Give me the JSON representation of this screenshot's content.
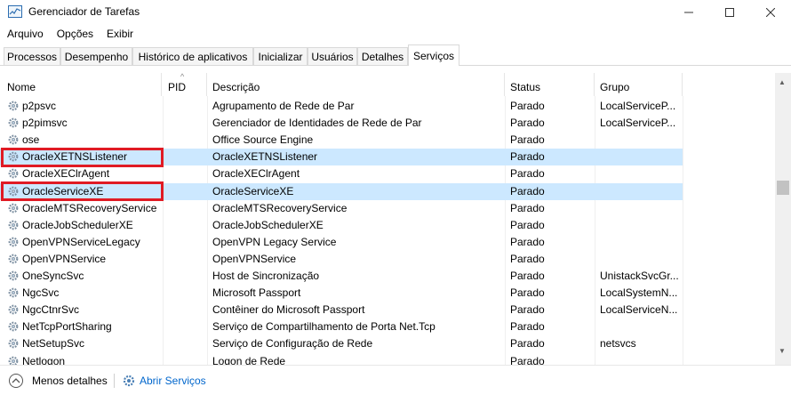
{
  "window": {
    "title": "Gerenciador de Tarefas",
    "minimize": "—",
    "maximize": "☐",
    "close": "✕"
  },
  "menu": [
    "Arquivo",
    "Opções",
    "Exibir"
  ],
  "tabs": [
    {
      "label": "Processos",
      "active": false
    },
    {
      "label": "Desempenho",
      "active": false
    },
    {
      "label": "Histórico de aplicativos",
      "active": false
    },
    {
      "label": "Inicializar",
      "active": false
    },
    {
      "label": "Usuários",
      "active": false
    },
    {
      "label": "Detalhes",
      "active": false
    },
    {
      "label": "Serviços",
      "active": true
    }
  ],
  "columns": {
    "name": "Nome",
    "pid": "PID",
    "description": "Descrição",
    "status": "Status",
    "group": "Grupo",
    "sort_indicator": "^"
  },
  "rows": [
    {
      "name": "p2psvc",
      "pid": "",
      "description": "Agrupamento de Rede de Par",
      "status": "Parado",
      "group": "LocalServiceP...",
      "selected": false,
      "highlighted": false
    },
    {
      "name": "p2pimsvc",
      "pid": "",
      "description": "Gerenciador de Identidades de Rede de Par",
      "status": "Parado",
      "group": "LocalServiceP...",
      "selected": false,
      "highlighted": false
    },
    {
      "name": "ose",
      "pid": "",
      "description": "Office  Source Engine",
      "status": "Parado",
      "group": "",
      "selected": false,
      "highlighted": false
    },
    {
      "name": "OracleXETNSListener",
      "pid": "",
      "description": "OracleXETNSListener",
      "status": "Parado",
      "group": "",
      "selected": true,
      "highlighted": true
    },
    {
      "name": "OracleXEClrAgent",
      "pid": "",
      "description": "OracleXEClrAgent",
      "status": "Parado",
      "group": "",
      "selected": false,
      "highlighted": false
    },
    {
      "name": "OracleServiceXE",
      "pid": "",
      "description": "OracleServiceXE",
      "status": "Parado",
      "group": "",
      "selected": true,
      "highlighted": true
    },
    {
      "name": "OracleMTSRecoveryService",
      "pid": "",
      "description": "OracleMTSRecoveryService",
      "status": "Parado",
      "group": "",
      "selected": false,
      "highlighted": false
    },
    {
      "name": "OracleJobSchedulerXE",
      "pid": "",
      "description": "OracleJobSchedulerXE",
      "status": "Parado",
      "group": "",
      "selected": false,
      "highlighted": false
    },
    {
      "name": "OpenVPNServiceLegacy",
      "pid": "",
      "description": "OpenVPN Legacy Service",
      "status": "Parado",
      "group": "",
      "selected": false,
      "highlighted": false
    },
    {
      "name": "OpenVPNService",
      "pid": "",
      "description": "OpenVPNService",
      "status": "Parado",
      "group": "",
      "selected": false,
      "highlighted": false
    },
    {
      "name": "OneSyncSvc",
      "pid": "",
      "description": "Host de Sincronização",
      "status": "Parado",
      "group": "UnistackSvcGr...",
      "selected": false,
      "highlighted": false
    },
    {
      "name": "NgcSvc",
      "pid": "",
      "description": "Microsoft Passport",
      "status": "Parado",
      "group": "LocalSystemN...",
      "selected": false,
      "highlighted": false
    },
    {
      "name": "NgcCtnrSvc",
      "pid": "",
      "description": "Contêiner do Microsoft Passport",
      "status": "Parado",
      "group": "LocalServiceN...",
      "selected": false,
      "highlighted": false
    },
    {
      "name": "NetTcpPortSharing",
      "pid": "",
      "description": "Serviço de Compartilhamento de Porta Net.Tcp",
      "status": "Parado",
      "group": "",
      "selected": false,
      "highlighted": false
    },
    {
      "name": "NetSetupSvc",
      "pid": "",
      "description": "Serviço de Configuração de Rede",
      "status": "Parado",
      "group": "netsvcs",
      "selected": false,
      "highlighted": false
    },
    {
      "name": "Netlogon",
      "pid": "",
      "description": "Logon de Rede",
      "status": "Parado",
      "group": "",
      "selected": false,
      "highlighted": false
    }
  ],
  "footer": {
    "less_details": "Menos detalhes",
    "open_services": "Abrir Serviços"
  },
  "colors": {
    "highlight_border": "#e01b24",
    "selected_row": "#cce8ff",
    "link": "#0066cc"
  }
}
